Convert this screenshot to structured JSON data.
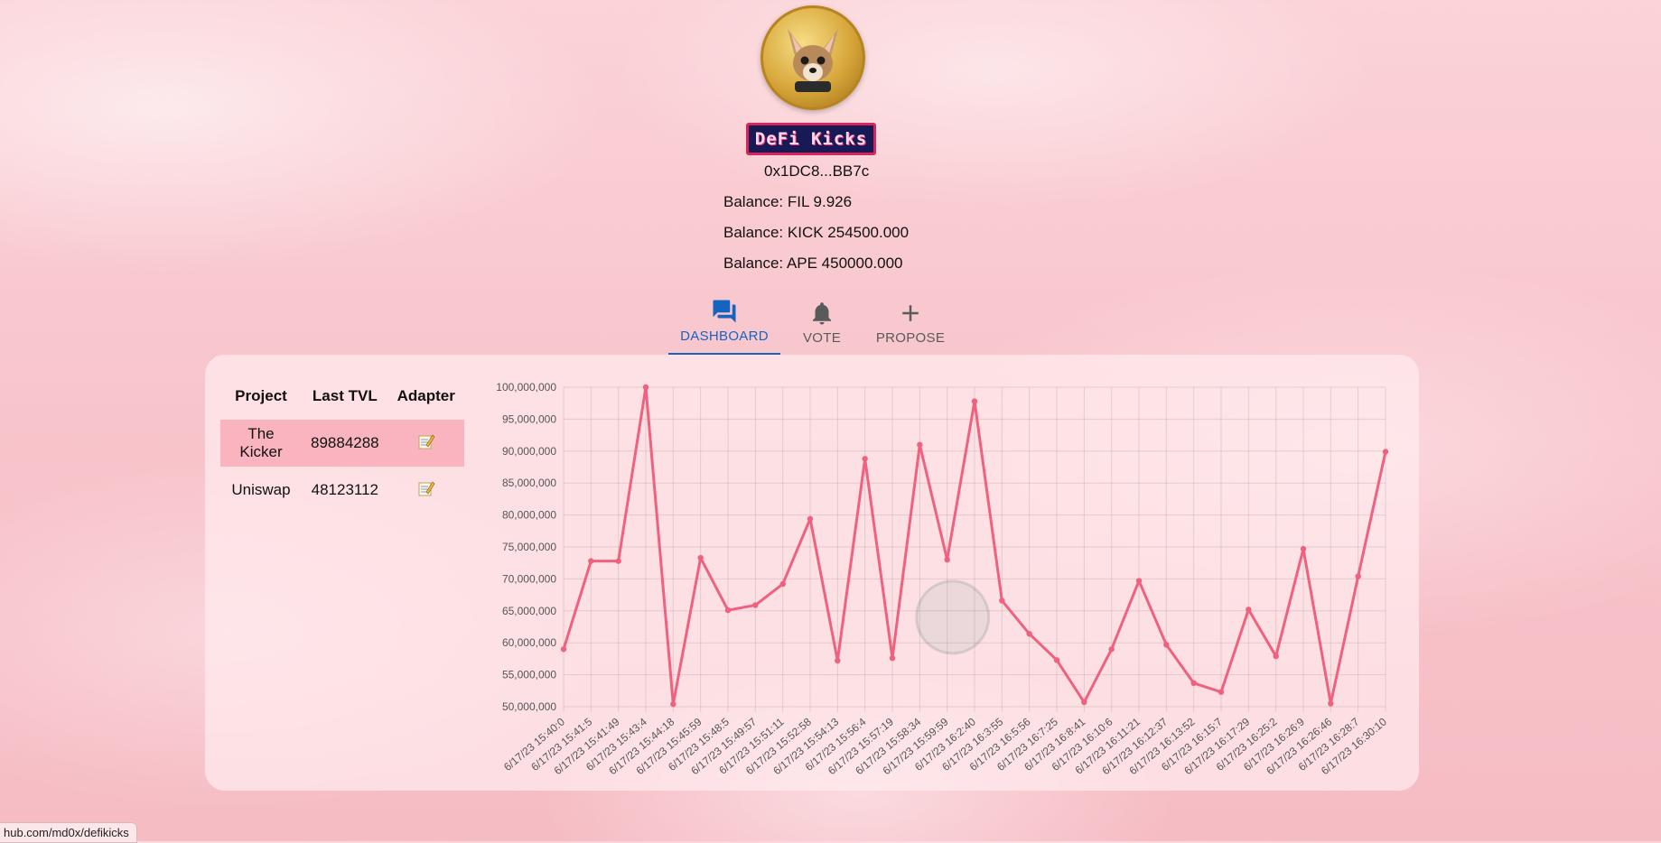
{
  "header": {
    "brand": "DeFi Kicks",
    "address": "0x1DC8...BB7c",
    "balances": [
      "Balance: FIL 9.926",
      "Balance: KICK 254500.000",
      "Balance: APE 450000.000"
    ]
  },
  "tabs": [
    {
      "label": "DASHBOARD",
      "icon": "forum-icon",
      "active": true
    },
    {
      "label": "VOTE",
      "icon": "bell-icon",
      "active": false
    },
    {
      "label": "PROPOSE",
      "icon": "plus-icon",
      "active": false
    }
  ],
  "table": {
    "headers": [
      "Project",
      "Last TVL",
      "Adapter"
    ],
    "rows": [
      {
        "project": "The Kicker",
        "tvl": "89884288",
        "adapter_icon": "memo-icon"
      },
      {
        "project": "Uniswap",
        "tvl": "48123112",
        "adapter_icon": "memo-icon"
      }
    ]
  },
  "status_bar": {
    "url": "hub.com/md0x/defikicks"
  },
  "colors": {
    "line": "#f0607f",
    "accent": "#1565c0",
    "brand_bg": "#171a55",
    "brand_border": "#d8245a"
  },
  "chart_data": {
    "type": "line",
    "ylim": [
      50000000,
      100000000
    ],
    "y_ticks": [
      "50,000,000",
      "55,000,000",
      "60,000,000",
      "65,000,000",
      "70,000,000",
      "75,000,000",
      "80,000,000",
      "85,000,000",
      "90,000,000",
      "95,000,000",
      "100,000,000"
    ],
    "categories": [
      "6/17/23 15:40:0",
      "6/17/23 15:41:5",
      "6/17/23 15:41:49",
      "6/17/23 15:43:4",
      "6/17/23 15:44:18",
      "6/17/23 15:45:59",
      "6/17/23 15:48:5",
      "6/17/23 15:49:57",
      "6/17/23 15:51:11",
      "6/17/23 15:52:58",
      "6/17/23 15:54:13",
      "6/17/23 15:56:4",
      "6/17/23 15:57:19",
      "6/17/23 15:58:34",
      "6/17/23 15:59:59",
      "6/17/23 16:2:40",
      "6/17/23 16:3:55",
      "6/17/23 16:5:56",
      "6/17/23 16:7:25",
      "6/17/23 16:8:41",
      "6/17/23 16:10:6",
      "6/17/23 16:11:21",
      "6/17/23 16:12:37",
      "6/17/23 16:13:52",
      "6/17/23 16:15:7",
      "6/17/23 16:17:29",
      "6/17/23 16:25:2",
      "6/17/23 16:26:9",
      "6/17/23 16:26:46",
      "6/17/23 16:28:7",
      "6/17/23 16:30:10"
    ],
    "values": [
      59000000,
      72800000,
      72800000,
      100000000,
      50400000,
      73300000,
      65100000,
      65900000,
      69200000,
      79400000,
      57200000,
      88800000,
      57600000,
      91000000,
      73000000,
      97800000,
      66600000,
      61400000,
      57300000,
      50700000,
      59000000,
      69700000,
      59700000,
      53700000,
      52300000,
      65200000,
      57900000,
      74700000,
      50500000,
      70400000,
      89900000
    ],
    "grid": true
  }
}
